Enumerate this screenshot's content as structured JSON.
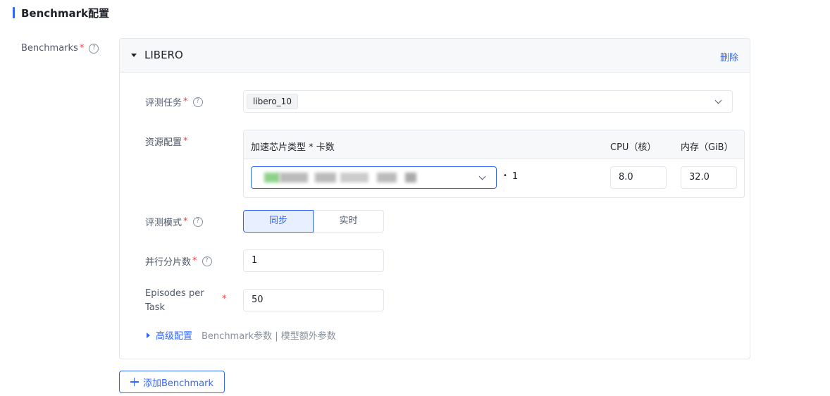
{
  "section": {
    "title": "Benchmark配置"
  },
  "benchmarks_label": "Benchmarks",
  "required_mark": "*",
  "help_glyph": "?",
  "card": {
    "title": "LIBERO",
    "delete_label": "删除",
    "task": {
      "label": "评测任务",
      "selected_tag": "libero_10"
    },
    "resource": {
      "label": "资源配置",
      "headers": {
        "accelerator": "加速芯片类型 * 卡数",
        "cpu": "CPU（核）",
        "memory": "内存（GiB）"
      },
      "multiplier_sign": "•",
      "card_count": "1",
      "cpu_value": "8.0",
      "memory_value": "32.0"
    },
    "mode": {
      "label": "评测模式",
      "options": [
        "同步",
        "实时"
      ],
      "selected": "同步"
    },
    "shards": {
      "label": "并行分片数",
      "value": "1"
    },
    "episodes": {
      "label_line1": "Episodes per",
      "label_line2": "Task",
      "value": "50"
    },
    "advanced": {
      "link": "高级配置",
      "desc": "Benchmark参数 | 模型额外参数"
    }
  },
  "add_button": "添加Benchmark",
  "colors": {
    "accent": "#3366ff",
    "required": "#f53f3f",
    "border": "#e5e6eb",
    "header_bg": "#f7f8fa"
  }
}
